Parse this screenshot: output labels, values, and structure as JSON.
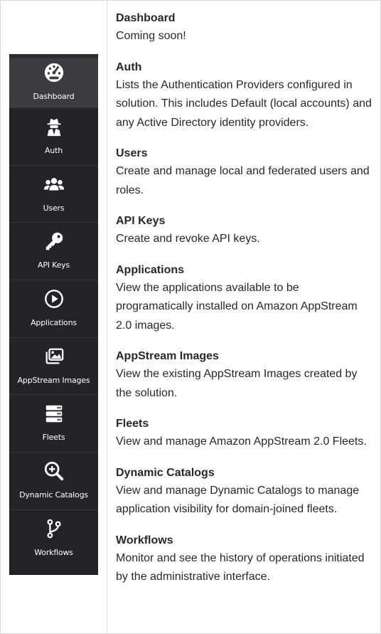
{
  "sidebar": {
    "items": [
      {
        "label": "Dashboard",
        "icon": "speedometer-icon",
        "active": true
      },
      {
        "label": "Auth",
        "icon": "user-secret-icon"
      },
      {
        "label": "Users",
        "icon": "users-icon"
      },
      {
        "label": "API Keys",
        "icon": "key-icon"
      },
      {
        "label": "Applications",
        "icon": "play-circle-icon"
      },
      {
        "label": "AppStream Images",
        "icon": "images-icon"
      },
      {
        "label": "Fleets",
        "icon": "server-icon"
      },
      {
        "label": "Dynamic Catalogs",
        "icon": "search-plus-icon"
      },
      {
        "label": "Workflows",
        "icon": "code-branch-icon"
      }
    ]
  },
  "sections": [
    {
      "title": "Dashboard",
      "description": "Coming soon!"
    },
    {
      "title": "Auth",
      "description": "Lists the Authentication Providers configured in solution. This includes Default (local accounts) and any Active Directory identity providers."
    },
    {
      "title": "Users",
      "description": "Create and manage local and federated users and roles."
    },
    {
      "title": "API Keys",
      "description": "Create and revoke API keys."
    },
    {
      "title": "Applications",
      "description": "View the applications available to be programatically installed on Amazon AppStream 2.0 images."
    },
    {
      "title": "AppStream Images",
      "description": "View the existing AppStream Images created by the solution."
    },
    {
      "title": "Fleets",
      "description": "View and manage Amazon AppStream 2.0 Fleets."
    },
    {
      "title": "Dynamic Catalogs",
      "description": "View and manage Dynamic Catalogs to manage application visibility for domain-joined fleets."
    },
    {
      "title": "Workflows",
      "description": "Monitor and see the history of operations initiated by the administrative interface."
    }
  ],
  "colors": {
    "sidebar_bg": "#232428",
    "sidebar_active_bg": "#3b3c40",
    "text": "#24292e"
  }
}
